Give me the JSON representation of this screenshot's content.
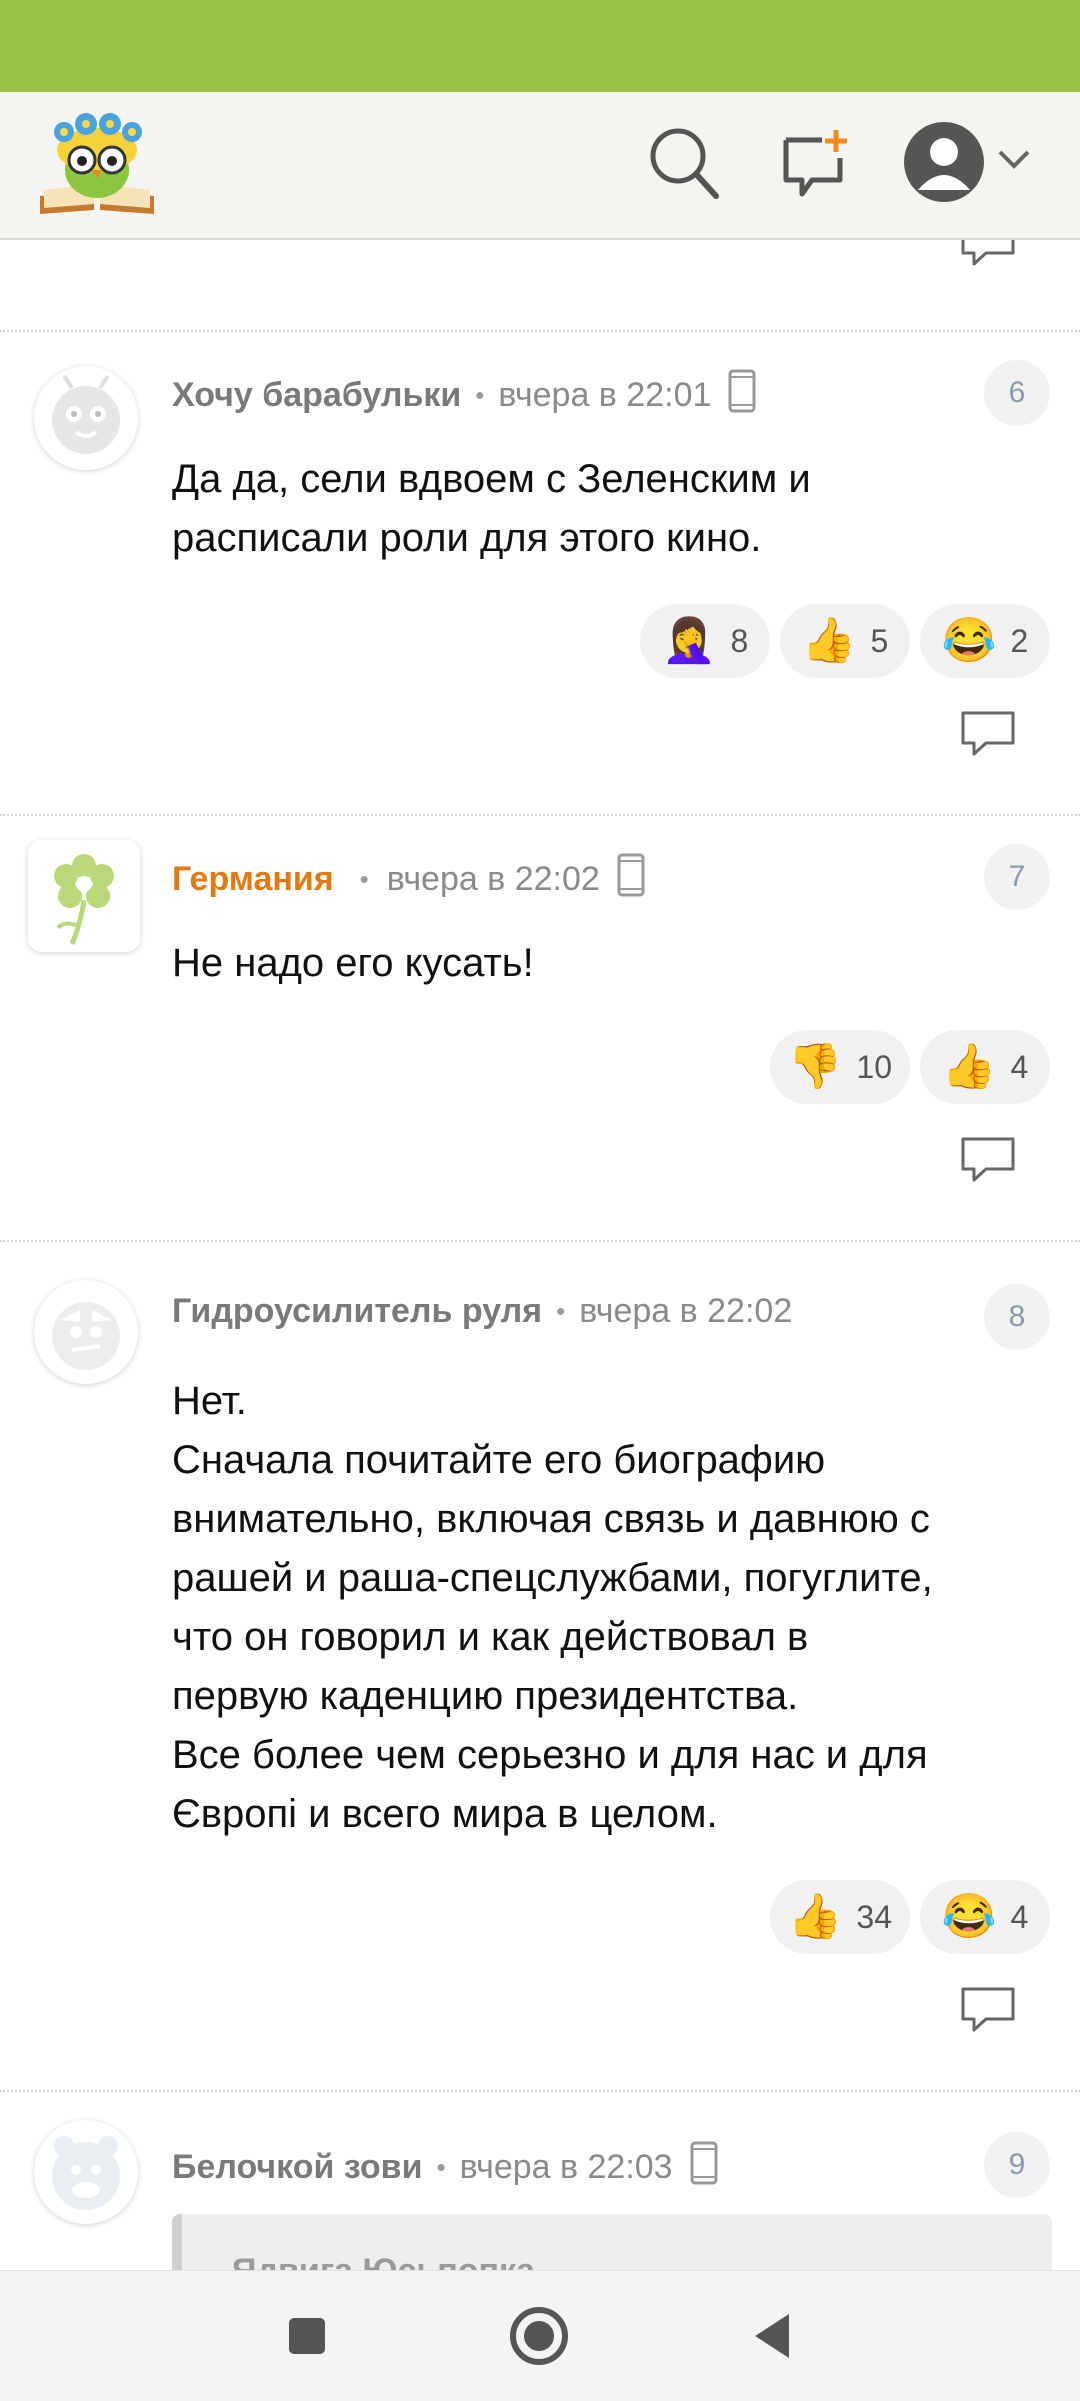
{
  "header": {
    "logo_icon": "owl-book-logo-icon",
    "search_icon": "search-icon",
    "new_post_icon": "new-message-icon",
    "profile_icon": "avatar-icon",
    "dropdown_icon": "chevron-down-icon"
  },
  "comments": [
    {
      "author": "Хочу барабульки",
      "time": "вчера в 22:01",
      "number": "6",
      "text": [
        "Да да, сели вдвоем с Зеленским и",
        "расписали роли для этого кино."
      ],
      "reactions": [
        {
          "emoji": "🤦‍♀️",
          "name": "facepalm",
          "count": "8"
        },
        {
          "emoji": "👍",
          "name": "thumbs-up",
          "count": "5"
        },
        {
          "emoji": "😂",
          "name": "laughing",
          "count": "2"
        }
      ]
    },
    {
      "author": "Германия",
      "time": "вчера в 22:02",
      "number": "7",
      "text": [
        "Не надо его кусать!"
      ],
      "reactions": [
        {
          "emoji": "👎",
          "name": "thumbs-down",
          "count": "10"
        },
        {
          "emoji": "👍",
          "name": "thumbs-up",
          "count": "4"
        }
      ]
    },
    {
      "author": "Гидроусилитель руля",
      "time": "вчера в 22:02",
      "number": "8",
      "text": [
        "Нет.",
        "Сначала почитайте его биографию",
        "внимательно, включая связь и давнюю с",
        "рашей и раша-спецслужбами, погуглите,",
        "что он говорил и как действовал в",
        "первую каденцию президентства.",
        "Все более чем серьезно и для нас и для",
        "Європі и всего мира в целом."
      ],
      "reactions": [
        {
          "emoji": "👍",
          "name": "thumbs-up",
          "count": "34"
        },
        {
          "emoji": "😂",
          "name": "laughing",
          "count": "4"
        }
      ]
    },
    {
      "author": "Белочкой зови",
      "time": "вчера в 22:03",
      "number": "9",
      "quote_author": "Ядвига Юсьпопка"
    }
  ],
  "navbar": {
    "recents_icon": "square-recents-icon",
    "home_icon": "circle-home-icon",
    "back_icon": "triangle-back-icon"
  },
  "colors": {
    "status_bar": "#9bc147",
    "author_highlight": "#e27a12"
  }
}
